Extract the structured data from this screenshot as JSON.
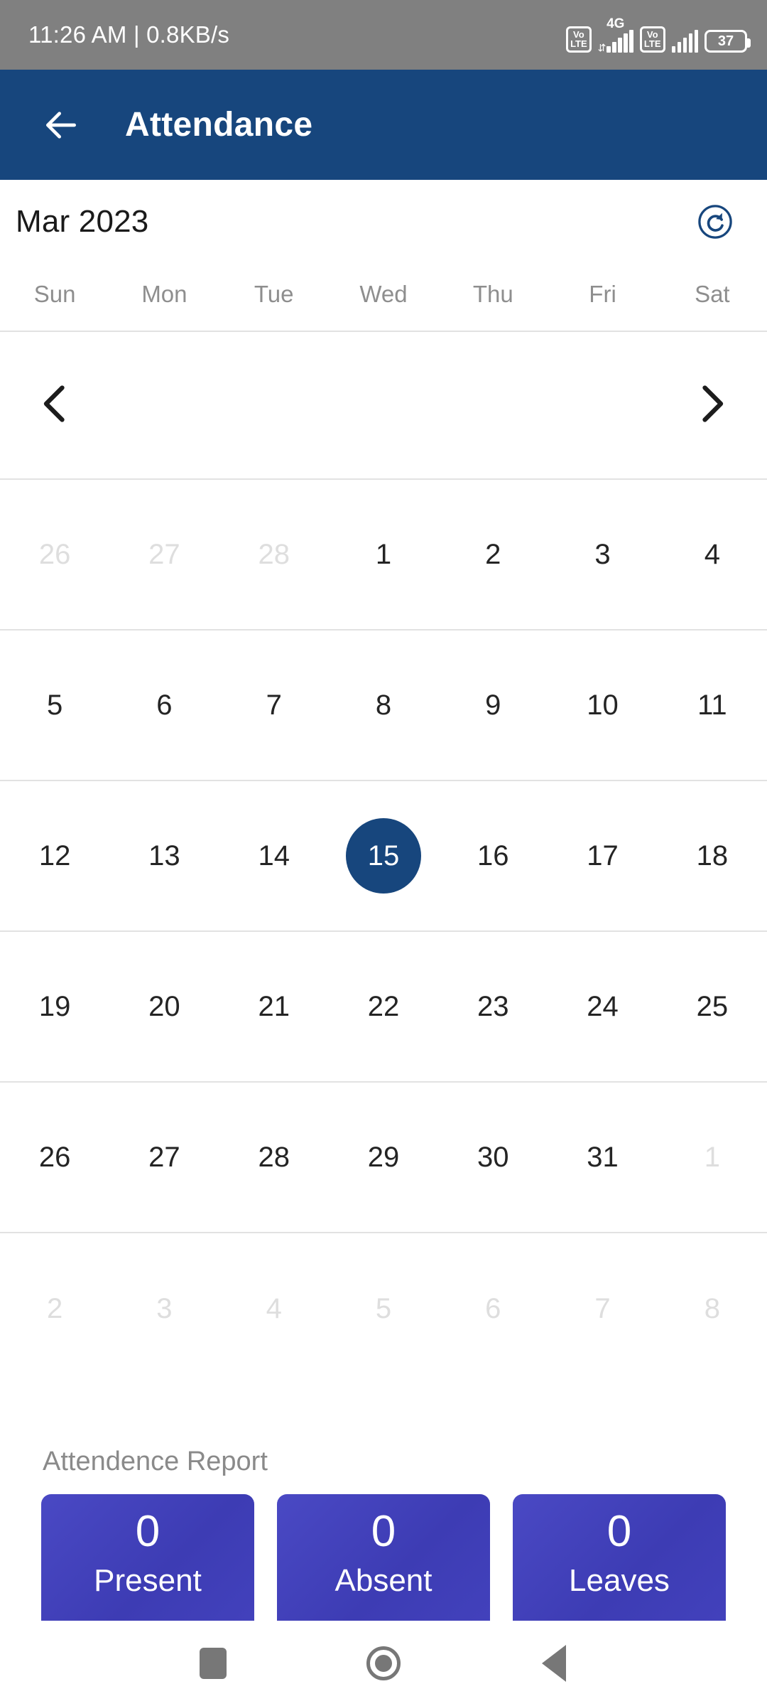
{
  "status_bar": {
    "time": "11:26 AM",
    "separator": "|",
    "network_speed": "0.8KB/s",
    "sim1_volte": "VoLTE",
    "sim1_network": "4G",
    "sim2_volte": "VoLTE",
    "battery_level": "37"
  },
  "app_bar": {
    "title": "Attendance",
    "back_icon": "arrow-left-icon"
  },
  "calendar": {
    "month_label": "Mar 2023",
    "refresh_icon": "refresh-icon",
    "prev_icon": "chevron-left-icon",
    "next_icon": "chevron-right-icon",
    "weekdays": [
      "Sun",
      "Mon",
      "Tue",
      "Wed",
      "Thu",
      "Fri",
      "Sat"
    ],
    "selected_day": "15",
    "weeks": [
      [
        {
          "d": "26",
          "muted": true
        },
        {
          "d": "27",
          "muted": true
        },
        {
          "d": "28",
          "muted": true
        },
        {
          "d": "1",
          "muted": false
        },
        {
          "d": "2",
          "muted": false
        },
        {
          "d": "3",
          "muted": false
        },
        {
          "d": "4",
          "muted": false
        }
      ],
      [
        {
          "d": "5",
          "muted": false
        },
        {
          "d": "6",
          "muted": false
        },
        {
          "d": "7",
          "muted": false
        },
        {
          "d": "8",
          "muted": false
        },
        {
          "d": "9",
          "muted": false
        },
        {
          "d": "10",
          "muted": false
        },
        {
          "d": "11",
          "muted": false
        }
      ],
      [
        {
          "d": "12",
          "muted": false
        },
        {
          "d": "13",
          "muted": false
        },
        {
          "d": "14",
          "muted": false
        },
        {
          "d": "15",
          "muted": false,
          "selected": true
        },
        {
          "d": "16",
          "muted": false
        },
        {
          "d": "17",
          "muted": false
        },
        {
          "d": "18",
          "muted": false
        }
      ],
      [
        {
          "d": "19",
          "muted": false
        },
        {
          "d": "20",
          "muted": false
        },
        {
          "d": "21",
          "muted": false
        },
        {
          "d": "22",
          "muted": false
        },
        {
          "d": "23",
          "muted": false
        },
        {
          "d": "24",
          "muted": false
        },
        {
          "d": "25",
          "muted": false
        }
      ],
      [
        {
          "d": "26",
          "muted": false
        },
        {
          "d": "27",
          "muted": false
        },
        {
          "d": "28",
          "muted": false
        },
        {
          "d": "29",
          "muted": false
        },
        {
          "d": "30",
          "muted": false
        },
        {
          "d": "31",
          "muted": false
        },
        {
          "d": "1",
          "muted": true
        }
      ],
      [
        {
          "d": "2",
          "muted": true
        },
        {
          "d": "3",
          "muted": true
        },
        {
          "d": "4",
          "muted": true
        },
        {
          "d": "5",
          "muted": true
        },
        {
          "d": "6",
          "muted": true
        },
        {
          "d": "7",
          "muted": true
        },
        {
          "d": "8",
          "muted": true
        }
      ]
    ]
  },
  "report": {
    "title": "Attendence Report",
    "cards": [
      {
        "value": "0",
        "label": "Present"
      },
      {
        "value": "0",
        "label": "Absent"
      },
      {
        "value": "0",
        "label": "Leaves"
      }
    ]
  },
  "system_nav": {
    "recents_icon": "square-icon",
    "home_icon": "circle-icon",
    "back_icon": "triangle-back-icon"
  },
  "colors": {
    "app_bar": "#17467d",
    "selected_day": "#17467d",
    "card": "#4342bd",
    "status_bar": "#808080",
    "muted_text": "#dedede"
  }
}
